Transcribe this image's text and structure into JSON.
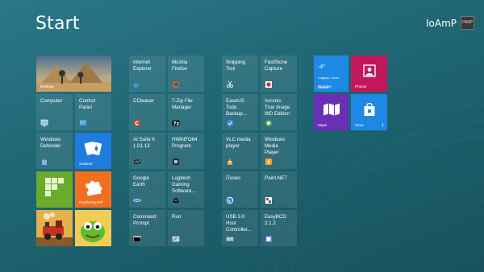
{
  "screen": {
    "title": "Start"
  },
  "user": {
    "name": "IoAmP",
    "avatar_text": "HWiP"
  },
  "colors": {
    "background": "#1f6573",
    "weather": "#1e88e5",
    "photos": "#c2185b",
    "maps": "#6a2fb5",
    "store": "#1e88e5",
    "solitaire": "#1e7be0",
    "block_game": "#6aaa2d",
    "pieces_game": "#f07020"
  },
  "group1": {
    "desktop": "Desktop",
    "computer": "Computer",
    "control_panel": "Control\nPanel",
    "defender": "Windows\nDefender",
    "solitaire": "Solitaire",
    "puzzle": "PuzzleTouch®"
  },
  "group2": {
    "ie": "Internet\nExplorer",
    "firefox": "Mozilla\nFirefox",
    "ccleaner": "CCleaner",
    "zip": "7-Zip File\nManager",
    "aisuite": "AI Suite II\n1.01.13",
    "hwinfo": "HWiNFO64\nProgram",
    "earth": "Google\nEarth",
    "logitech": "Logitech\nGaming\nSoftware...",
    "cmd": "Command\nPrompt",
    "run": "Run"
  },
  "group3": {
    "snipping": "Snipping\nTool",
    "faststone": "FastStone\nCapture",
    "easeus": "EaseUS\nTodo\nBackup...",
    "acronis": "Acronis\nTrue Image\nWD Edition",
    "vlc": "VLC media\nplayer",
    "wmp": "Windows\nMedia\nPlayer",
    "itunes": "iTunes",
    "paint": "Paint.NET",
    "usb": "USB 3.0\nHost\nController...",
    "easybcd": "EasyBCD\n2.1.2"
  },
  "group4": {
    "weather_temp": "-4°",
    "weather_loc": "Calgary, Cana...",
    "weather_cond": "Flurries",
    "weather": "Weather",
    "photos": "Photos",
    "maps": "Maps",
    "store": "Store",
    "store_count": "1"
  }
}
